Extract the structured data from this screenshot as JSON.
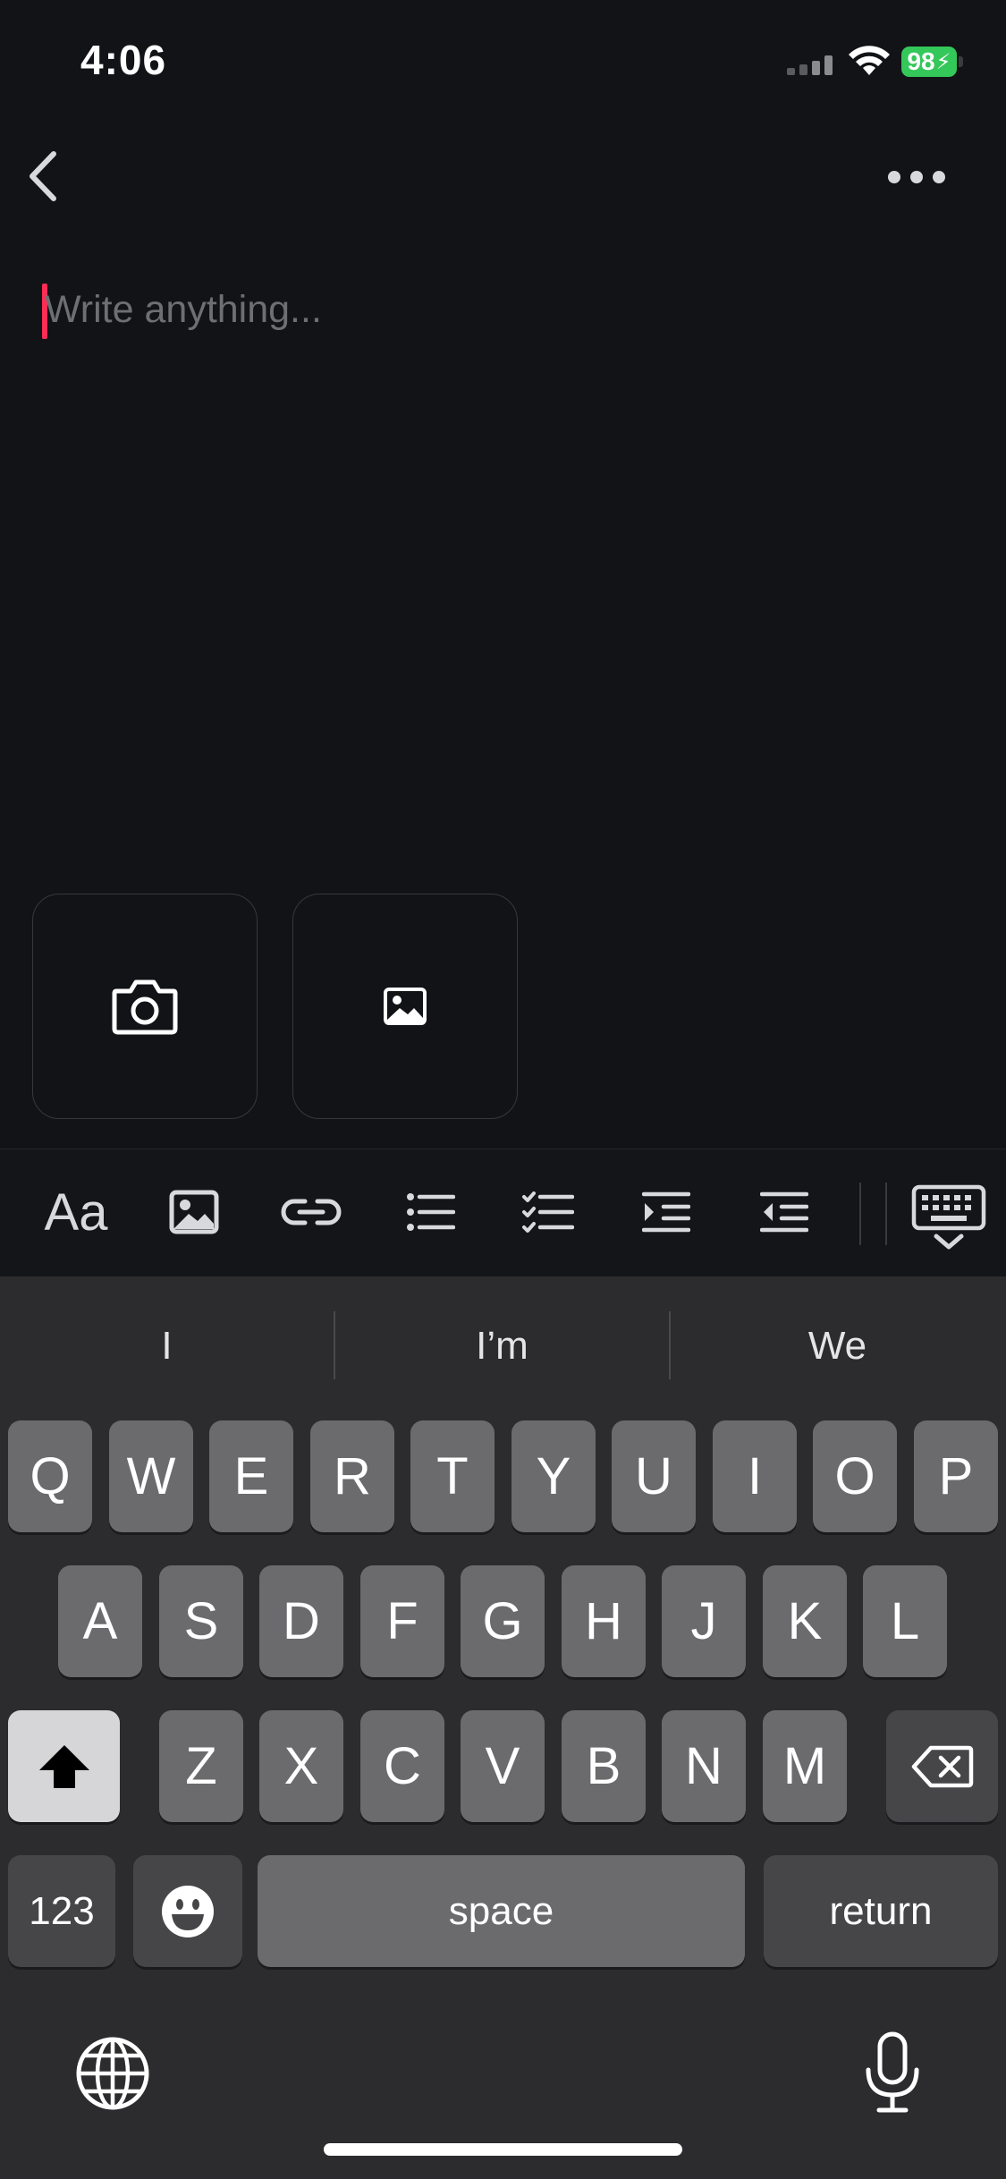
{
  "status_bar": {
    "time": "4:06",
    "battery": "98"
  },
  "editor": {
    "placeholder": "Write anything..."
  },
  "suggestions": [
    "I",
    "I’m",
    "We"
  ],
  "keyboard": {
    "row1": [
      "Q",
      "W",
      "E",
      "R",
      "T",
      "Y",
      "U",
      "I",
      "O",
      "P"
    ],
    "row2": [
      "A",
      "S",
      "D",
      "F",
      "G",
      "H",
      "J",
      "K",
      "L"
    ],
    "row3": [
      "Z",
      "X",
      "C",
      "V",
      "B",
      "N",
      "M"
    ],
    "numbers_label": "123",
    "space_label": "space",
    "return_label": "return"
  },
  "toolbar": {
    "text_style_label": "Aa"
  },
  "icons": {
    "back": "chevron-left-icon",
    "more": "ellipsis-icon",
    "camera": "camera-icon",
    "photo": "image-icon",
    "link": "link-icon",
    "bullet_list": "bullet-list-icon",
    "checklist": "checklist-icon",
    "indent": "indent-icon",
    "outdent": "outdent-icon",
    "hide_keyboard": "keyboard-dismiss-icon",
    "shift": "shift-icon",
    "delete": "backspace-icon",
    "emoji": "emoji-icon",
    "globe": "globe-icon",
    "mic": "microphone-icon"
  },
  "colors": {
    "background": "#121317",
    "caret": "#ff2d55",
    "battery": "#34c759",
    "keyboard": "#2c2c2e"
  }
}
